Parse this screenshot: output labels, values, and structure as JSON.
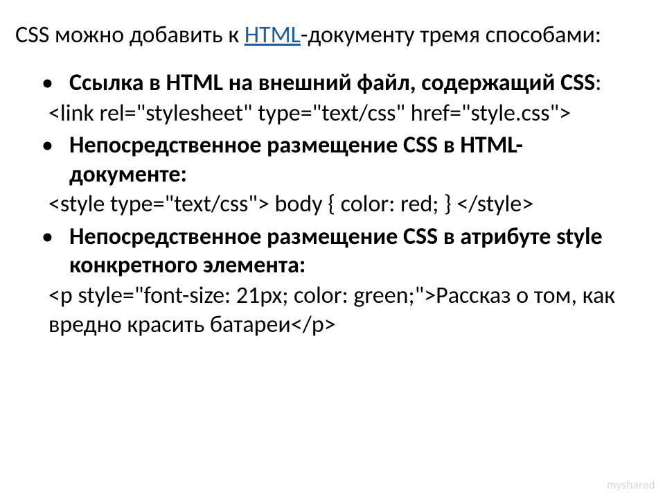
{
  "intro": {
    "prefix": "CSS можно добавить к ",
    "link": "HTML",
    "suffix": "-документу тремя способами:"
  },
  "bullets": {
    "b1": "Ссылка в HTML на внешний файл, содержащий CSS",
    "b1_code": "<link rel=\"stylesheet\" type=\"text/css\" href=\"style.css\">",
    "b2": "Непосредственное размещение CSS в HTML-документе:",
    "b2_code": "<style type=\"text/css\">       body { color: red; }   </style>",
    "b3": "Непосредственное размещение CSS в атрибуте style конкретного элемента:",
    "b3_code": "<p style=\"font-size: 21px; color: green;\">Рассказ о том, как вредно красить батареи</p>"
  },
  "watermark": "myshared"
}
